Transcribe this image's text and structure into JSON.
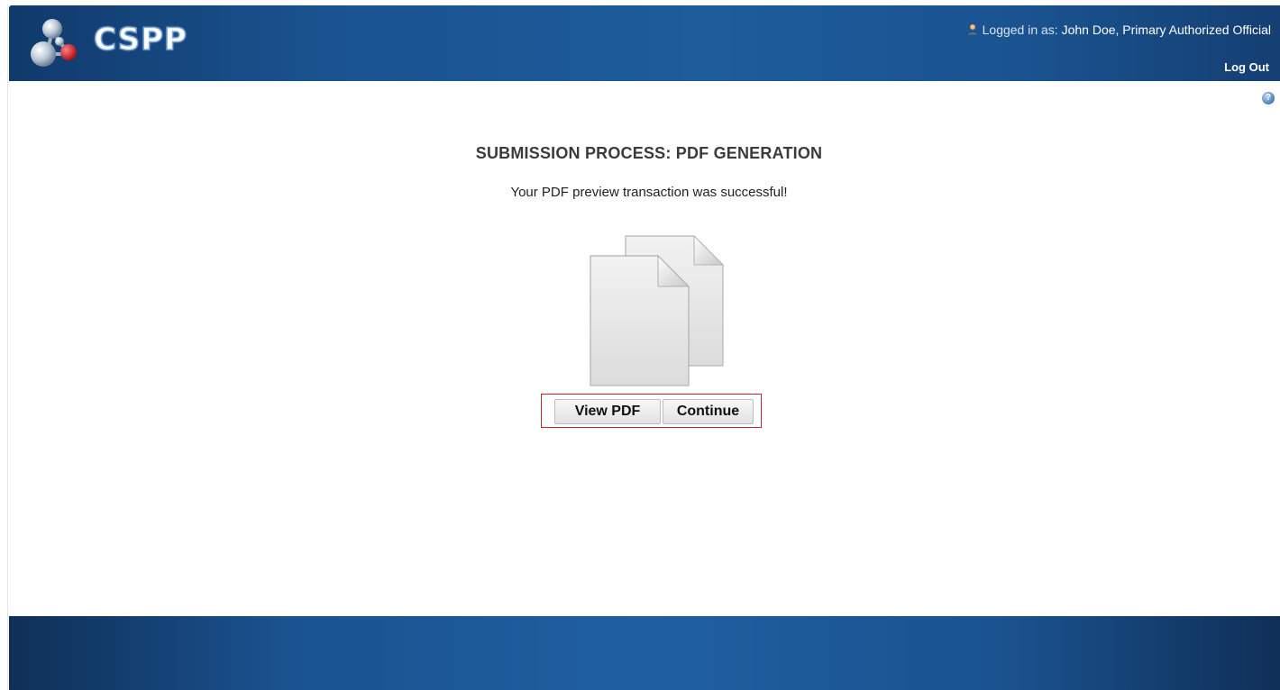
{
  "app": {
    "logo_text": "CSPP"
  },
  "header": {
    "user_prefix": "Logged in as:",
    "user_name": "John Doe, Primary Authorized Official",
    "logout_label": "Log Out"
  },
  "main": {
    "title": "SUBMISSION PROCESS: PDF GENERATION",
    "message": "Your PDF preview transaction was successful!",
    "buttons": {
      "view_pdf": "View PDF",
      "continue": "Continue"
    }
  },
  "icons": {
    "logo": "cspp-logo-icon",
    "user": "user-icon",
    "help": "help-icon",
    "documents": "documents-icon"
  },
  "colors": {
    "header_blue": "#1a5390",
    "footer_blue": "#1a5390",
    "highlight_border": "#c0262d"
  }
}
